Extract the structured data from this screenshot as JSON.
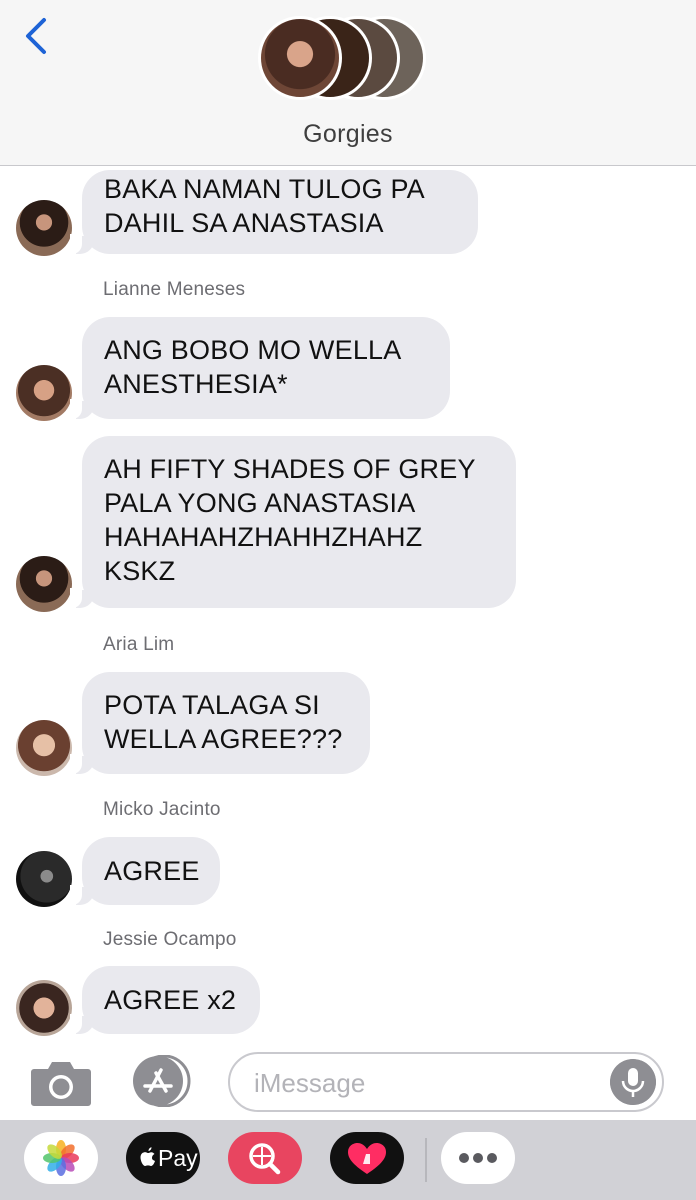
{
  "header": {
    "group_name": "Gorgies",
    "back_icon": "chevron-left-icon",
    "accent": "#1e63d6"
  },
  "messages": [
    {
      "sender": "",
      "avatar": "wella",
      "lines": [
        "BAKA NAMAN TULOG PA",
        "DAHIL SA ANASTASIA"
      ]
    },
    {
      "sender": "Lianne Meneses",
      "avatar": "lianne",
      "lines": [
        "ANG BOBO MO WELLA",
        "ANESTHESIA*"
      ]
    },
    {
      "sender": "",
      "avatar": "wella",
      "lines": [
        "AH FIFTY SHADES OF GREY",
        "PALA YONG ANASTASIA",
        "HAHAHAHZHAHHZHAHZ",
        "KSKZ"
      ]
    },
    {
      "sender": "Aria Lim",
      "avatar": "aria",
      "lines": [
        "POTA TALAGA SI",
        "WELLA AGREE???"
      ]
    },
    {
      "sender": "Micko Jacinto",
      "avatar": "micko",
      "lines": [
        "AGREE"
      ]
    },
    {
      "sender": "Jessie Ocampo",
      "avatar": "jessie",
      "lines": [
        "AGREE x2"
      ]
    }
  ],
  "input_bar": {
    "placeholder": "iMessage",
    "camera_icon": "camera-icon",
    "appstore_icon": "app-store-icon",
    "mic_icon": "microphone-icon"
  },
  "app_drawer": {
    "apps": [
      {
        "icon": "photos-icon"
      },
      {
        "icon": "apple-pay-icon",
        "label": "Pay"
      },
      {
        "icon": "image-search-icon"
      },
      {
        "icon": "digital-touch-icon"
      },
      {
        "icon": "more-icon"
      }
    ]
  }
}
